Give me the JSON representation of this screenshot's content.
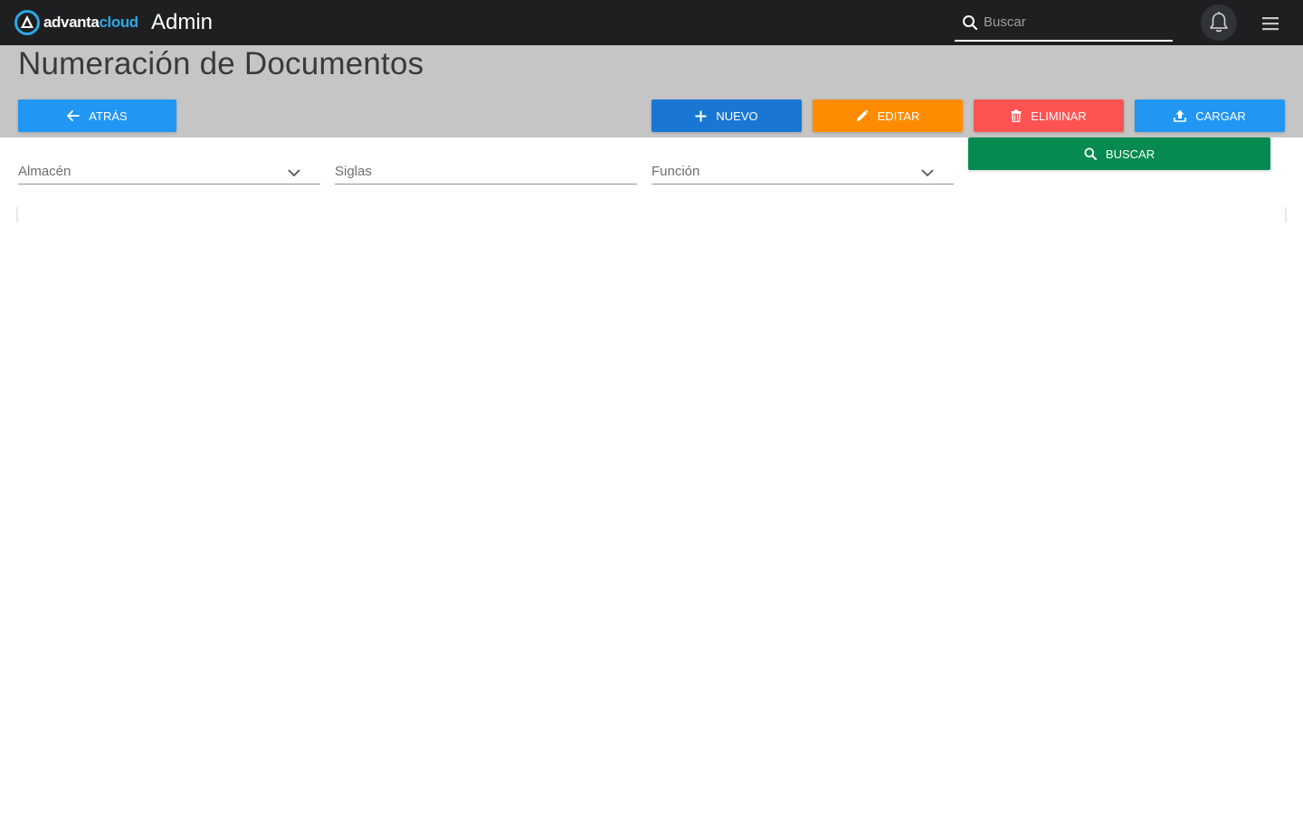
{
  "app": {
    "logo_text_part1": "advanta",
    "logo_text_part2": "cloud",
    "title": "Admin",
    "brand_color": "#2aa8e6"
  },
  "topbar": {
    "search_placeholder": "Buscar",
    "search_value": "",
    "icons": [
      "search-icon",
      "bell-icon",
      "hamburger-menu-icon"
    ]
  },
  "page": {
    "title": "Numeración de Documentos"
  },
  "toolbar": {
    "back_label": "ATRÁS",
    "new_label": "NUEVO",
    "edit_label": "EDITAR",
    "delete_label": "ELIMINAR",
    "upload_label": "CARGAR",
    "search_label": "BUSCAR",
    "colors": {
      "back": "#2196f3",
      "new": "#1976d2",
      "edit": "#ff8c00",
      "delete": "#ff5252",
      "upload": "#2196f3",
      "search": "#058a50"
    }
  },
  "filters": {
    "almacen_label": "Almacén",
    "siglas_label": "Siglas",
    "funcion_label": "Función"
  }
}
